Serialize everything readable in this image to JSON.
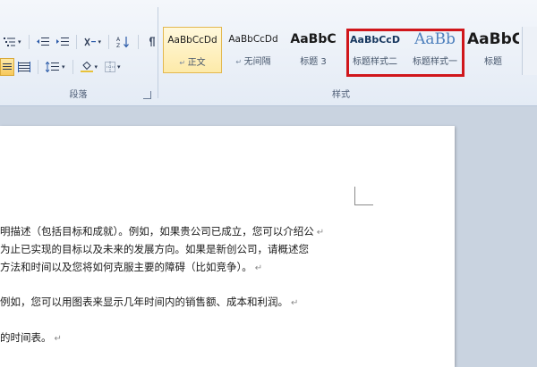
{
  "ribbon": {
    "paragraph_group": {
      "label": "段落"
    },
    "styles_group": {
      "label": "样式",
      "styles": [
        {
          "sample": "AaBbCcDd",
          "name": "正文",
          "selected": true
        },
        {
          "sample": "AaBbCcDd",
          "name": "无间隔",
          "selected": false
        },
        {
          "sample": "AaBbC",
          "name": "标题 3",
          "selected": false
        },
        {
          "sample": "AaBbCcD",
          "name": "标题样式二",
          "selected": false
        },
        {
          "sample": "AaBb",
          "name": "标题样式一",
          "selected": false
        },
        {
          "sample": "AaBbC",
          "name": "标题",
          "selected": false
        }
      ]
    },
    "highlight_color": "#d0161b"
  },
  "document": {
    "lines": [
      "明描述（包括目标和成就）。例如，如果贵公司已成立，您可以介绍公",
      "为止已实现的目标以及未来的发展方向。如果是新创公司，请概述您",
      "方法和时间以及您将如何克服主要的障碍（比如竞争）。",
      "例如，您可以用图表来显示几年时间内的销售额、成本和利润。",
      "的时间表。"
    ],
    "paragraph_mark": "↵"
  }
}
